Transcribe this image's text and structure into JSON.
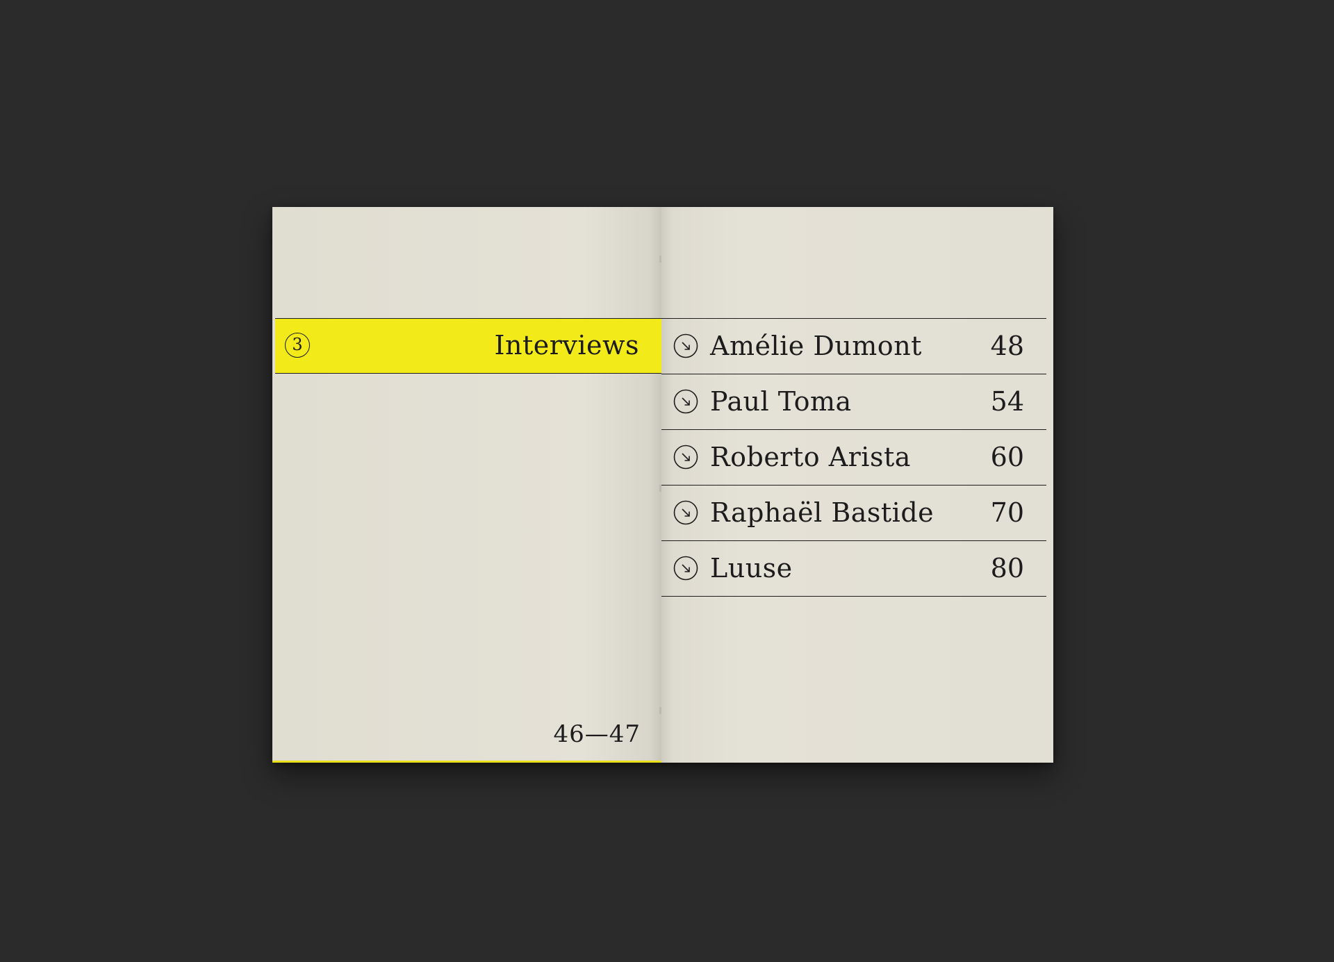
{
  "left_page": {
    "section_number": "3",
    "section_title": "Interviews",
    "page_numbers": "46—47"
  },
  "right_page": {
    "entries": [
      {
        "name": "Amélie Dumont",
        "page": "48",
        "icon": "arrow-down-right-circle-icon"
      },
      {
        "name": "Paul Toma",
        "page": "54",
        "icon": "arrow-down-right-circle-icon"
      },
      {
        "name": "Roberto Arista",
        "page": "60",
        "icon": "arrow-down-right-circle-icon"
      },
      {
        "name": "Raphaël Bastide",
        "page": "70",
        "icon": "arrow-down-right-circle-icon"
      },
      {
        "name": "Luuse",
        "page": "80",
        "icon": "arrow-down-right-circle-icon"
      }
    ]
  },
  "colors": {
    "background": "#2b2b2b",
    "paper": "#e3e0d5",
    "highlight": "#f3ea1a",
    "ink": "#1c1c1c"
  }
}
